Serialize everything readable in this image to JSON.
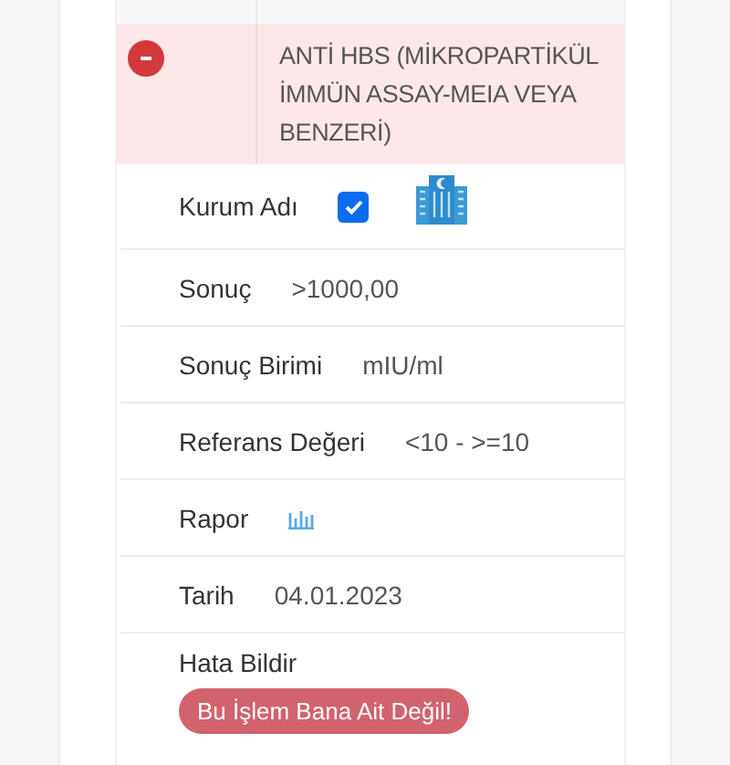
{
  "test": {
    "name": "ANTİ HBS (MİKROPARTİKÜL İMMÜN ASSAY-MEIA VEYA BENZERİ)",
    "expanded": true
  },
  "details": [
    {
      "kind": "checkbox",
      "label": "Kurum Adı",
      "checked": true
    },
    {
      "kind": "text",
      "label": "Sonuç",
      "value": ">1000,00"
    },
    {
      "kind": "text",
      "label": "Sonuç Birimi",
      "value": "mIU/ml"
    },
    {
      "kind": "text",
      "label": "Referans Değeri",
      "value": "<10 - >=10"
    },
    {
      "kind": "report",
      "label": "Rapor"
    },
    {
      "kind": "text",
      "label": "Tarih",
      "value": "04.01.2023"
    },
    {
      "kind": "button",
      "label": "Hata Bildir",
      "button": "Bu İşlem Bana Ait Değil!"
    }
  ]
}
